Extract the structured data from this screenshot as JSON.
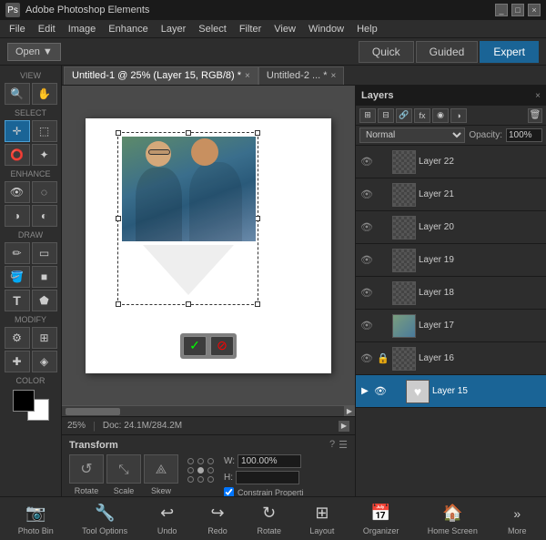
{
  "titlebar": {
    "title": "Adobe Photoshop Elements",
    "logo": "Ps",
    "controls": [
      "_",
      "□",
      "×"
    ]
  },
  "menubar": {
    "items": [
      "File",
      "Edit",
      "Image",
      "Enhance",
      "Layer",
      "Select",
      "Filter",
      "View",
      "Window",
      "Help"
    ]
  },
  "modebar": {
    "open_label": "Open",
    "open_arrow": "▼",
    "tabs": [
      "Quick",
      "Guided",
      "Expert"
    ],
    "active_tab": "Expert"
  },
  "view_label": "VIEW",
  "select_label": "SELECT",
  "enhance_label": "ENHANCE",
  "draw_label": "DRAW",
  "modify_label": "MODIFY",
  "color_label": "COLOR",
  "tabs": [
    {
      "label": "Untitled-1 @ 25% (Layer 15, RGB/8) *",
      "active": true
    },
    {
      "label": "Untitled-2 ... *",
      "active": false
    }
  ],
  "status": {
    "zoom": "25%",
    "doc": "Doc: 24.1M/284.2M"
  },
  "transform_panel": {
    "title": "Transform",
    "help_icon": "?",
    "settings_icon": "☰",
    "buttons": [
      {
        "icon": "↺",
        "label": "Rotate"
      },
      {
        "icon": "⤡",
        "label": "Scale"
      },
      {
        "icon": "⟁",
        "label": "Skew"
      }
    ],
    "w_label": "W:",
    "w_value": "100.00%",
    "h_label": "H:",
    "constrain_label": "Constrain Properti",
    "constrain_checked": true
  },
  "layers_panel": {
    "title": "Layers",
    "close": "×",
    "blend_mode": "Normal",
    "opacity_label": "Opacity:",
    "opacity_value": "100%",
    "layers": [
      {
        "name": "Layer 22",
        "visible": true,
        "locked": false,
        "active": false,
        "has_thumb": false
      },
      {
        "name": "Layer 21",
        "visible": true,
        "locked": false,
        "active": false,
        "has_thumb": false
      },
      {
        "name": "Layer 20",
        "visible": true,
        "locked": false,
        "active": false,
        "has_thumb": false
      },
      {
        "name": "Layer 19",
        "visible": true,
        "locked": false,
        "active": false,
        "has_thumb": false
      },
      {
        "name": "Layer 18",
        "visible": true,
        "locked": false,
        "active": false,
        "has_thumb": false
      },
      {
        "name": "Layer 17",
        "visible": true,
        "locked": false,
        "active": false,
        "has_thumb": true
      },
      {
        "name": "Layer 16",
        "visible": true,
        "locked": false,
        "active": false,
        "has_thumb": false
      },
      {
        "name": "Layer 15",
        "visible": true,
        "locked": false,
        "active": true,
        "has_thumb": true
      }
    ],
    "toolbar_icons": [
      "⊞",
      "⊟",
      "⊕",
      "⊗",
      "⊘",
      "≡"
    ]
  },
  "bottom_toolbar": {
    "items": [
      {
        "icon": "📷",
        "label": "Photo Bin"
      },
      {
        "icon": "🔧",
        "label": "Tool Options"
      },
      {
        "icon": "↩",
        "label": "Undo"
      },
      {
        "icon": "↪",
        "label": "Redo"
      },
      {
        "icon": "↻",
        "label": "Rotate"
      },
      {
        "icon": "⊞",
        "label": "Layout"
      },
      {
        "icon": "📅",
        "label": "Organizer"
      },
      {
        "icon": "🏠",
        "label": "Home Screen"
      },
      {
        "icon": "»",
        "label": "More"
      }
    ]
  },
  "confirm": {
    "yes": "✓",
    "no": "⊘"
  }
}
